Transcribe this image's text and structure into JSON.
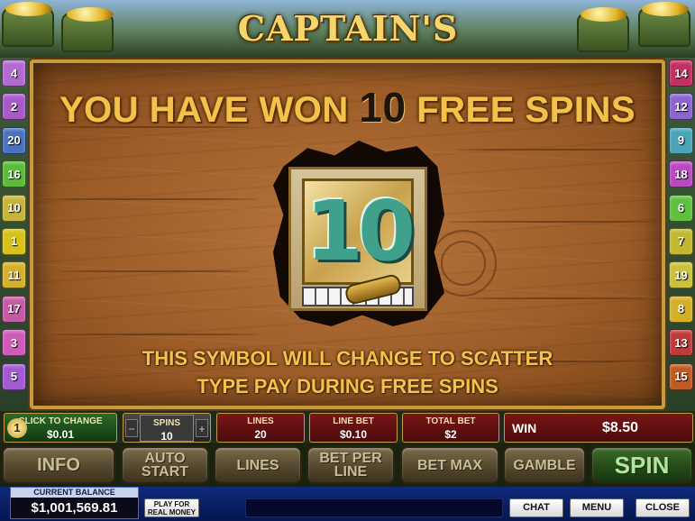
{
  "game": {
    "title": "CAPTAIN'S TREASURE"
  },
  "side_lines": {
    "left": [
      {
        "label": "4",
        "color": "#b36ad0"
      },
      {
        "label": "2",
        "color": "#a75ac8"
      },
      {
        "label": "20",
        "color": "#4a72c0"
      },
      {
        "label": "16",
        "color": "#5dbb3a"
      },
      {
        "label": "10",
        "color": "#c7b53a"
      },
      {
        "label": "1",
        "color": "#d8c21a"
      },
      {
        "label": "11",
        "color": "#d6b02c"
      },
      {
        "label": "17",
        "color": "#c85aa4"
      },
      {
        "label": "3",
        "color": "#d05ab8"
      },
      {
        "label": "5",
        "color": "#a25ad2"
      }
    ],
    "right": [
      {
        "label": "14",
        "color": "#c23060"
      },
      {
        "label": "12",
        "color": "#8a64d0"
      },
      {
        "label": "9",
        "color": "#4aa4b8"
      },
      {
        "label": "18",
        "color": "#b84ac0"
      },
      {
        "label": "6",
        "color": "#5ec040"
      },
      {
        "label": "7",
        "color": "#c2b830"
      },
      {
        "label": "19",
        "color": "#cbc13a"
      },
      {
        "label": "8",
        "color": "#d4b028"
      },
      {
        "label": "13",
        "color": "#c03a3a"
      },
      {
        "label": "15",
        "color": "#c05a22"
      }
    ]
  },
  "message": {
    "win_prefix": "YOU HAVE WON",
    "win_count": "10",
    "win_suffix": "FREE SPINS",
    "scatter_line1": "THIS SYMBOL WILL CHANGE TO SCATTER",
    "scatter_line2": "TYPE PAY DURING FREE SPINS"
  },
  "symbol": {
    "value": "10"
  },
  "controls": {
    "coin": {
      "circle": "1",
      "label": "CLICK TO CHANGE",
      "value": "$0.01"
    },
    "spins": {
      "label": "SPINS",
      "value": "10",
      "minus": "−",
      "plus": "+"
    },
    "lines": {
      "label": "LINES",
      "value": "20"
    },
    "line_bet": {
      "label": "LINE BET",
      "value": "$0.10"
    },
    "total_bet": {
      "label": "TOTAL BET",
      "value": "$2"
    },
    "win": {
      "label": "WIN",
      "value": "$8.50"
    }
  },
  "buttons": {
    "info": "INFO",
    "auto_start": "AUTO START",
    "lines": "LINES",
    "bet_per_line": "BET PER LINE",
    "bet_max": "BET MAX",
    "gamble": "GAMBLE",
    "spin": "SPIN"
  },
  "footer": {
    "balance_label": "CURRENT BALANCE",
    "balance_value": "$1,001,569.81",
    "play_real": "PLAY FOR REAL MONEY",
    "chat": "CHAT",
    "menu": "MENU",
    "close": "CLOSE"
  }
}
